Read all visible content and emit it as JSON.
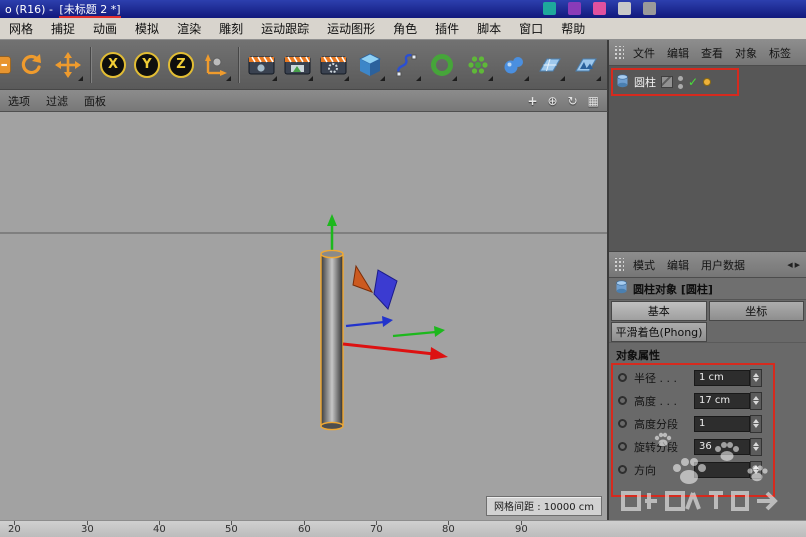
{
  "titlebar": {
    "title_prefix": "o (R16) - ",
    "title_doc": "[未标题 2 *]"
  },
  "menubar": {
    "items": [
      "网格",
      "捕捉",
      "动画",
      "模拟",
      "渲染",
      "雕刻",
      "运动跟踪",
      "运动图形",
      "角色",
      "插件",
      "脚本",
      "窗口",
      "帮助"
    ]
  },
  "toolbar": {
    "axis_x": "X",
    "axis_y": "Y",
    "axis_z": "Z"
  },
  "viewport": {
    "menus": [
      "选项",
      "过滤",
      "面板"
    ],
    "grid_spacing": "网格间距 : 10000 cm",
    "ruler_ticks": [
      "20",
      "30",
      "40",
      "50",
      "60",
      "70",
      "80",
      "90"
    ]
  },
  "object_manager": {
    "menus": [
      "文件",
      "编辑",
      "查看",
      "对象",
      "标签"
    ],
    "object_name": "圆柱"
  },
  "attribute_manager": {
    "menus": [
      "模式",
      "编辑",
      "用户数据"
    ],
    "title": "圆柱对象 [圆柱]",
    "tabs": {
      "basic": "基本",
      "coord": "坐标",
      "phong": "平滑着色(Phong)"
    },
    "section_title": "对象属性",
    "rows": [
      {
        "label": "半径 . . .",
        "value": "1 cm"
      },
      {
        "label": "高度 . . .",
        "value": "17 cm"
      },
      {
        "label": "高度分段",
        "value": "1"
      },
      {
        "label": "旋转分段",
        "value": "36"
      },
      {
        "label": "方向",
        "value": ""
      }
    ]
  },
  "colors": {
    "annotation_red": "#d62a1e",
    "accent_orange": "#ef9b2d",
    "selection_orange": "#f0a832",
    "axis_x_red": "#dd1111",
    "axis_y_green": "#1db81d",
    "axis_z_blue": "#2233cc"
  }
}
